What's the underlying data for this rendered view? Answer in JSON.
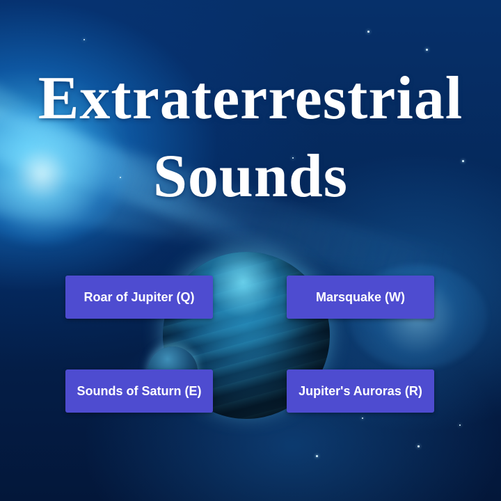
{
  "title": {
    "line1": "Extraterrestrial",
    "line2": "Sounds"
  },
  "buttons": [
    {
      "label": "Roar of Jupiter (Q)",
      "key": "Q"
    },
    {
      "label": "Marsquake (W)",
      "key": "W"
    },
    {
      "label": "Sounds of Saturn (E)",
      "key": "E"
    },
    {
      "label": "Jupiter's Auroras (R)",
      "key": "R"
    }
  ],
  "colors": {
    "button_bg": "#4e4cd0",
    "button_text": "#ffffff",
    "title_text": "#ffffff",
    "space_bg": "#05285a"
  }
}
